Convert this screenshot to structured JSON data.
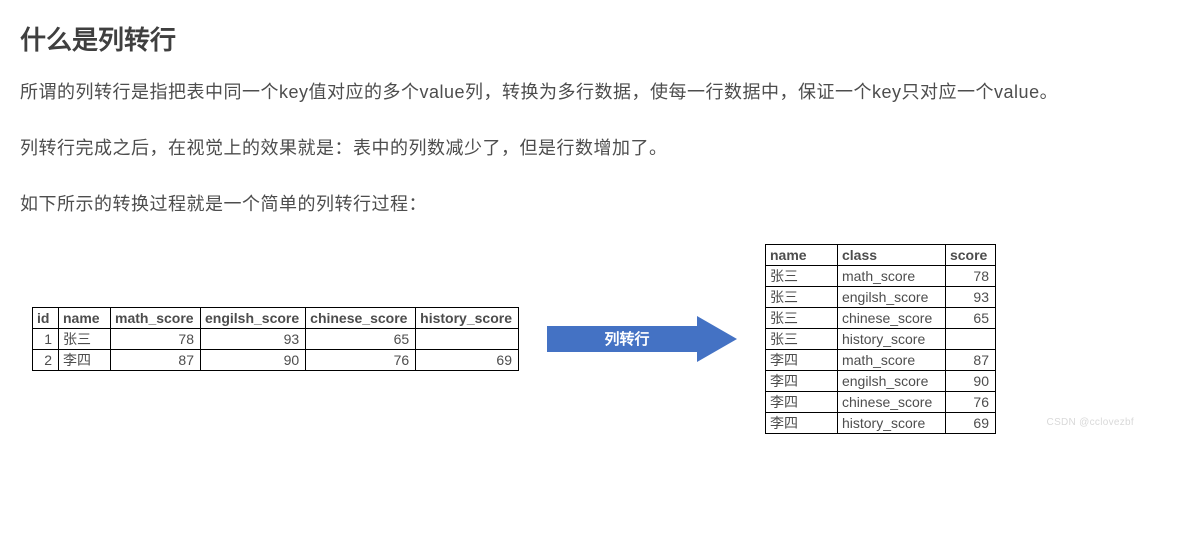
{
  "heading": "什么是列转行",
  "para1": "所谓的列转行是指把表中同一个key值对应的多个value列，转换为多行数据，使每一行数据中，保证一个key只对应一个value。",
  "para2": "列转行完成之后，在视觉上的效果就是：表中的列数减少了，但是行数增加了。",
  "para3": "如下所示的转换过程就是一个简单的列转行过程：",
  "arrow_label": "列转行",
  "left_table": {
    "headers": [
      "id",
      "name",
      "math_score",
      "engilsh_score",
      "chinese_score",
      "history_score"
    ],
    "rows": [
      {
        "id": "1",
        "name": "张三",
        "math": "78",
        "eng": "93",
        "chi": "65",
        "his": ""
      },
      {
        "id": "2",
        "name": "李四",
        "math": "87",
        "eng": "90",
        "chi": "76",
        "his": "69"
      }
    ]
  },
  "right_table": {
    "headers": [
      "name",
      "class",
      "score"
    ],
    "rows": [
      {
        "name": "张三",
        "class": "math_score",
        "score": "78"
      },
      {
        "name": "张三",
        "class": "engilsh_score",
        "score": "93"
      },
      {
        "name": "张三",
        "class": "chinese_score",
        "score": "65"
      },
      {
        "name": "张三",
        "class": "history_score",
        "score": ""
      },
      {
        "name": "李四",
        "class": "math_score",
        "score": "87"
      },
      {
        "name": "李四",
        "class": "engilsh_score",
        "score": "90"
      },
      {
        "name": "李四",
        "class": "chinese_score",
        "score": "76"
      },
      {
        "name": "李四",
        "class": "history_score",
        "score": "69"
      }
    ]
  },
  "watermark": "CSDN @cclovezbf",
  "colors": {
    "arrow": "#4472c4"
  }
}
